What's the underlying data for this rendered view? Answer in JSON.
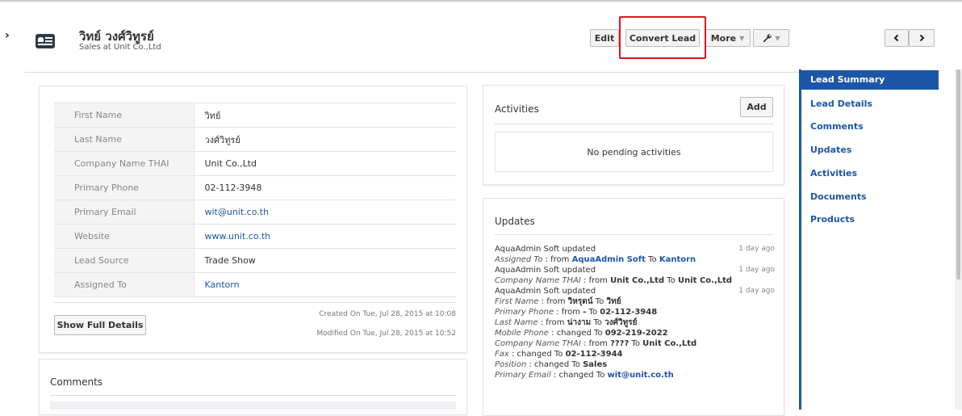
{
  "record": {
    "name": "วิทย์ วงศ์วิทูรย์",
    "subtitle": "Sales at Unit Co.,Ltd"
  },
  "header": {
    "edit": "Edit",
    "convert": "Convert Lead",
    "more": "More",
    "tools_icon": "wrench-icon",
    "prev_icon": "chevron-left-icon",
    "next_icon": "chevron-right-icon"
  },
  "summary": {
    "rows": [
      {
        "label": "First Name",
        "value": "วิทย์"
      },
      {
        "label": "Last Name",
        "value": "วงศ์วิทูรย์"
      },
      {
        "label": "Company Name THAI",
        "value": "Unit Co.,Ltd"
      },
      {
        "label": "Primary Phone",
        "value": "02-112-3948"
      },
      {
        "label": "Primary Email",
        "value": "wit@unit.co.th"
      },
      {
        "label": "Website",
        "value": "www.unit.co.th"
      },
      {
        "label": "Lead Source",
        "value": "Trade Show"
      },
      {
        "label": "Assigned To",
        "value": "Kantorn"
      }
    ],
    "show_full": "Show Full Details",
    "created": "Created On Tue, Jul 28, 2015 at 10:08",
    "modified": "Modified On Tue, Jul 28, 2015 at 10:52"
  },
  "comments": {
    "title": "Comments"
  },
  "activities": {
    "title": "Activities",
    "add": "Add",
    "empty": "No pending activities"
  },
  "updates": {
    "title": "Updates",
    "entries": [
      {
        "who": "AquaAdmin Soft",
        "verb": "updated",
        "time": "1 day ago",
        "lines": [
          {
            "field": "Assigned To",
            "from": "AquaAdmin Soft",
            "to": "Kantorn"
          }
        ]
      },
      {
        "who": "AquaAdmin Soft",
        "verb": "updated",
        "time": "1 day ago",
        "lines": [
          {
            "field": "Company Name THAI",
            "from": "Unit Co.,Ltd",
            "to": "Unit Co.,Ltd"
          }
        ]
      },
      {
        "who": "AquaAdmin Soft",
        "verb": "updated",
        "time": "1 day ago",
        "lines": [
          {
            "field": "First Name",
            "from": "วิหรุดน์",
            "to": "วิทย์"
          },
          {
            "field": "Primary Phone",
            "from": "-",
            "to": "02-112-3948"
          },
          {
            "field": "Last Name",
            "from": "น่างาม",
            "to": "วงศ์วิทูรย์"
          },
          {
            "field": "Mobile Phone",
            "changed": "092-219-2022"
          },
          {
            "field": "Company Name THAI",
            "from": "????",
            "to": "Unit Co.,Ltd"
          },
          {
            "field": "Fax",
            "changed": "02-112-3944"
          },
          {
            "field": "Position",
            "changed": "Sales"
          },
          {
            "field": "Primary Email",
            "changed": "wit@unit.co.th"
          }
        ]
      }
    ],
    "from_word": "from",
    "to_word": "To",
    "changed_word": "changed To"
  },
  "sidebar": {
    "active": "Lead Summary",
    "items": [
      "Lead Details",
      "Comments",
      "Updates",
      "Activities",
      "Documents",
      "Products"
    ]
  }
}
